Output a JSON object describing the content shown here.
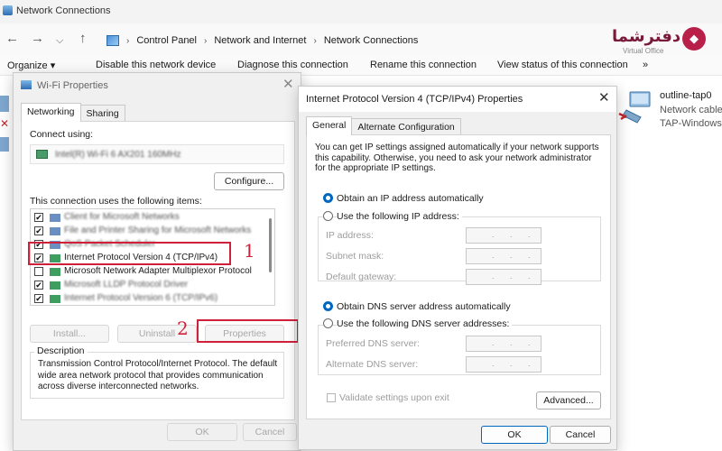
{
  "explorer": {
    "title": "Network Connections",
    "breadcrumb": [
      "Control Panel",
      "Network and Internet",
      "Network Connections"
    ],
    "commands": [
      "Organize ▾",
      "Disable this network device",
      "Diagnose this connection",
      "Rename this connection",
      "View status of this connection",
      "»"
    ],
    "adapter": {
      "name": "outline-tap0",
      "status": "Network cable",
      "device": "TAP-Windows A"
    },
    "watermark": {
      "brand": "دفترشما",
      "sub": "Virtual Office"
    }
  },
  "wifi": {
    "title": "Wi-Fi Properties",
    "tabs": [
      "Networking",
      "Sharing"
    ],
    "connect_using_label": "Connect using:",
    "adapter_name": "Intel(R) Wi-Fi 6 AX201 160MHz",
    "configure_label": "Configure...",
    "items_label": "This connection uses the following items:",
    "items": [
      {
        "text": "Client for Microsoft Networks",
        "checked": true,
        "blurred": true
      },
      {
        "text": "File and Printer Sharing for Microsoft Networks",
        "checked": true,
        "blurred": true
      },
      {
        "text": "QoS Packet Scheduler",
        "checked": true,
        "blurred": true
      },
      {
        "text": "Internet Protocol Version 4 (TCP/IPv4)",
        "checked": true,
        "blurred": false
      },
      {
        "text": "Microsoft Network Adapter Multiplexor Protocol",
        "checked": false,
        "blurred": false
      },
      {
        "text": "Microsoft LLDP Protocol Driver",
        "checked": true,
        "blurred": true
      },
      {
        "text": "Internet Protocol Version 6 (TCP/IPv6)",
        "checked": true,
        "blurred": true
      }
    ],
    "install_label": "Install...",
    "uninstall_label": "Uninstall",
    "properties_label": "Properties",
    "description_title": "Description",
    "description_text": "Transmission Control Protocol/Internet Protocol. The default wide area network protocol that provides communication across diverse interconnected networks.",
    "ok_label": "OK",
    "cancel_label": "Cancel"
  },
  "ipv4": {
    "title": "Internet Protocol Version 4 (TCP/IPv4) Properties",
    "tabs": [
      "General",
      "Alternate Configuration"
    ],
    "intro": "You can get IP settings assigned automatically if your network supports this capability. Otherwise, you need to ask your network administrator for the appropriate IP settings.",
    "obtain_ip_auto": "Obtain an IP address automatically",
    "use_following_ip": "Use the following IP address:",
    "ip_address_label": "IP address:",
    "subnet_mask_label": "Subnet mask:",
    "default_gateway_label": "Default gateway:",
    "obtain_dns_auto": "Obtain DNS server address automatically",
    "use_following_dns": "Use the following DNS server addresses:",
    "preferred_dns_label": "Preferred DNS server:",
    "alternate_dns_label": "Alternate DNS server:",
    "validate_label": "Validate settings upon exit",
    "advanced_label": "Advanced...",
    "ok_label": "OK",
    "cancel_label": "Cancel"
  },
  "annotations": {
    "step1": "1",
    "step2": "2"
  },
  "colors": {
    "accent": "#0067c0",
    "annotation": "#d0213a"
  }
}
